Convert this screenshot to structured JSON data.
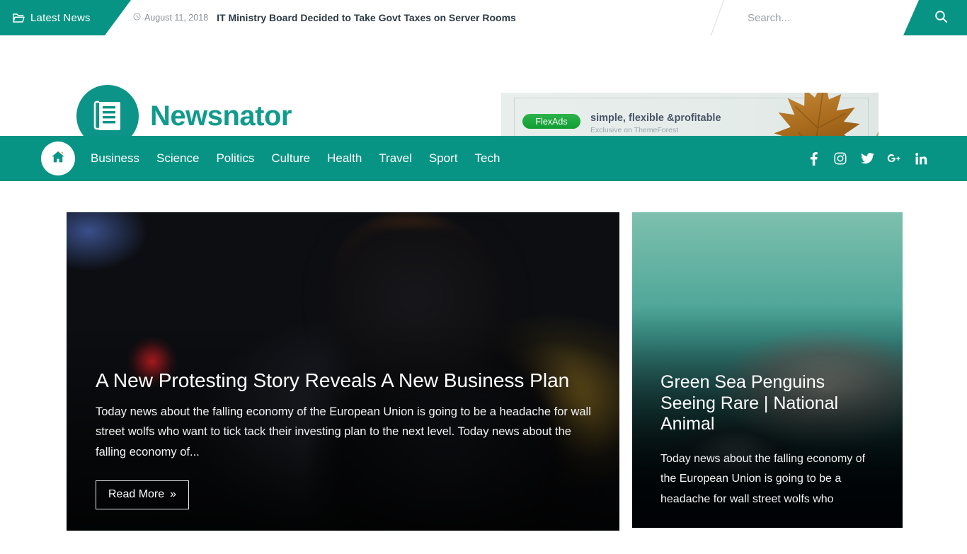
{
  "topbar": {
    "latest_news_label": "Latest News",
    "folder_icon": "folder-open-icon",
    "clock_icon": "clock-icon",
    "ticker_date": "August 11, 2018",
    "ticker_headline": "IT Ministry Board Decided to Take Govt Taxes on Server Rooms",
    "search_placeholder": "Search...",
    "search_value": "",
    "search_icon": "search-icon",
    "accent_color": "#089484"
  },
  "header": {
    "brand_name": "Newsnator",
    "brand_icon": "newspaper-icon",
    "brand_color": "#119b8c",
    "ad": {
      "pill_label": "FlexAds",
      "pill_color": "#0f9e33",
      "title": "simple, flexible &profitable",
      "subtitle": "Exclusive on ThemeForest",
      "image_icon": "maple-leaf-image"
    }
  },
  "nav": {
    "home_icon": "home-icon",
    "items": [
      {
        "label": "Business"
      },
      {
        "label": "Science"
      },
      {
        "label": "Politics"
      },
      {
        "label": "Culture"
      },
      {
        "label": "Health"
      },
      {
        "label": "Travel"
      },
      {
        "label": "Sport"
      },
      {
        "label": "Tech"
      }
    ],
    "social": [
      {
        "name": "facebook-icon"
      },
      {
        "name": "instagram-icon"
      },
      {
        "name": "twitter-icon"
      },
      {
        "name": "google-plus-icon"
      },
      {
        "name": "linkedin-icon"
      }
    ]
  },
  "main": {
    "featured": {
      "image_icon": "street-protest-photo",
      "title": "A New Protesting Story Reveals A New Business Plan",
      "excerpt": "Today news about the falling economy of the European Union is going to be a headache for wall street wolfs who want to tick tack their investing plan to the next level. Today news about the falling economy of...",
      "read_more_label": "Read More",
      "read_more_chevron": "»"
    },
    "secondary": {
      "image_icon": "penguin-swimming-photo",
      "title": "Green Sea Penguins Seeing Rare | National Animal",
      "excerpt": "Today news about the falling economy of the European Union is going to be a headache for wall street wolfs who"
    }
  }
}
